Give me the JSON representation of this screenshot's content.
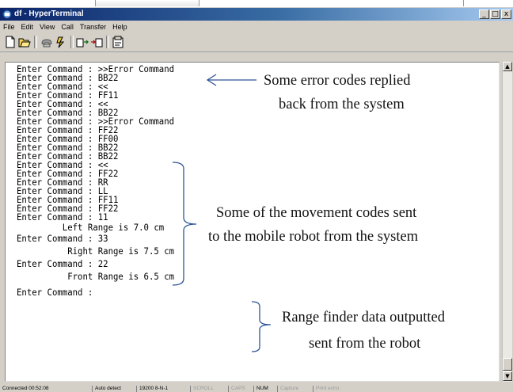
{
  "window": {
    "title": "df - HyperTerminal",
    "buttons": [
      "_",
      "□",
      "x"
    ]
  },
  "menu": [
    "File",
    "Edit",
    "View",
    "Call",
    "Transfer",
    "Help"
  ],
  "toolbar_icons": [
    "new-icon",
    "open-icon",
    "call-icon",
    "disconnect-icon",
    "send-icon",
    "receive-icon",
    "properties-icon"
  ],
  "terminal": {
    "lines": [
      "Enter Command : >>Error Command",
      "Enter Command : BB22",
      "Enter Command : <<",
      "Enter Command : FF11",
      "Enter Command : <<",
      "Enter Command : BB22",
      "Enter Command : >>Error Command",
      "Enter Command : FF22",
      "Enter Command : FF00",
      "Enter Command : BB22",
      "Enter Command : BB22",
      "Enter Command : <<",
      "Enter Command : FF22",
      "Enter Command : RR",
      "Enter Command : LL",
      "Enter Command : FF11",
      "Enter Command : FF22",
      "Enter Command : 11",
      "         Left Range is 7.0 cm",
      "Enter Command : 33",
      "          Right Range is 7.5 cm",
      "Enter Command : 22",
      "          Front Range is 6.5 cm",
      "Enter Command :"
    ]
  },
  "annotations": {
    "error_codes": [
      "Some  error codes replied",
      "back from the system"
    ],
    "movement_codes": [
      "Some of the movement codes sent",
      "to the mobile robot from the system"
    ],
    "range_finder": [
      "Range finder data outputted",
      "sent from the robot"
    ]
  },
  "status": {
    "connected": "Connected 00:52:08",
    "detect": "Auto detect",
    "port": "19200 8-N-1",
    "scroll": "SCROLL",
    "caps": "CAPS",
    "num": "NUM",
    "capture": "Capture",
    "print": "Print echo"
  },
  "colors": {
    "title_bar_start": "#0a246a",
    "title_bar_end": "#a6caf0",
    "chrome": "#d4d0c8",
    "annotation_lines": "#2f5597"
  }
}
